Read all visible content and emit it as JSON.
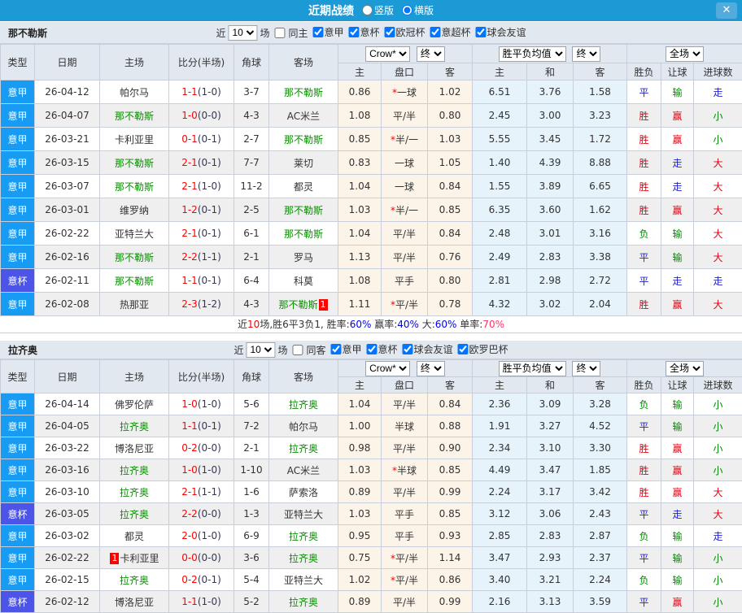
{
  "titlebar": {
    "title": "近期战绩",
    "radios": [
      {
        "label": "竖版",
        "checked": false
      },
      {
        "label": "横版",
        "checked": true
      }
    ],
    "close_label": "✕"
  },
  "colors": {
    "titlebar_bg": "#1b9ad6",
    "league_type_bg": "#189bf2",
    "cup_type_bg": "#4c55e8",
    "focus_team_green": "#089000",
    "score_red": "#ff0000",
    "win_red": "#e60012",
    "draw_blue": "#1f1fd0",
    "lose_green": "#008800",
    "asian_odds_bg": "#fcf4e8",
    "euro_odds_bg": "#e6f3fa"
  },
  "filter": {
    "near": "近",
    "count": "10",
    "games": "场"
  },
  "table_header": {
    "type": "类型",
    "date": "日期",
    "home": "主场",
    "score": "比分(半场)",
    "corner": "角球",
    "away": "客场",
    "asian": {
      "source": "Crow*",
      "final": "终",
      "home": "主",
      "line": "盘口",
      "away": "客"
    },
    "euro": {
      "source": "胜平负均值",
      "final": "终",
      "home": "主",
      "draw": "和",
      "away": "客"
    },
    "result": {
      "scope": "全场",
      "outcome": "胜负",
      "handicap": "让球",
      "goals": "进球数"
    }
  },
  "sections": [
    {
      "team": "那不勒斯",
      "same": {
        "label": "同主",
        "checked": false
      },
      "leagues": [
        {
          "label": "意甲",
          "checked": true
        },
        {
          "label": "意杯",
          "checked": true
        },
        {
          "label": "欧冠杯",
          "checked": true
        },
        {
          "label": "意超杯",
          "checked": true
        },
        {
          "label": "球会友谊",
          "checked": true
        }
      ],
      "rows": [
        {
          "type": "意甲",
          "cup": false,
          "date": "26-04-12",
          "home": "帕尔马",
          "home_green": false,
          "score": "1-1",
          "half": "(1-0)",
          "corner": "3-7",
          "away": "那不勒斯",
          "away_green": true,
          "o1": "0.86",
          "line": "*一球",
          "o2": "1.02",
          "e1": "6.51",
          "e2": "3.76",
          "e3": "1.58",
          "res": "平",
          "hand": "输",
          "goals": "走"
        },
        {
          "type": "意甲",
          "cup": false,
          "date": "26-04-07",
          "home": "那不勒斯",
          "home_green": true,
          "score": "1-0",
          "half": "(0-0)",
          "corner": "4-3",
          "away": "AC米兰",
          "away_green": false,
          "o1": "1.08",
          "line": "平/半",
          "o2": "0.80",
          "e1": "2.45",
          "e2": "3.00",
          "e3": "3.23",
          "res": "胜",
          "hand": "赢",
          "goals": "小"
        },
        {
          "type": "意甲",
          "cup": false,
          "date": "26-03-21",
          "home": "卡利亚里",
          "home_green": false,
          "score": "0-1",
          "half": "(0-1)",
          "corner": "2-7",
          "away": "那不勒斯",
          "away_green": true,
          "o1": "0.85",
          "line": "*半/一",
          "o2": "1.03",
          "e1": "5.55",
          "e2": "3.45",
          "e3": "1.72",
          "res": "胜",
          "hand": "赢",
          "goals": "小"
        },
        {
          "type": "意甲",
          "cup": false,
          "date": "26-03-15",
          "home": "那不勒斯",
          "home_green": true,
          "score": "2-1",
          "half": "(0-1)",
          "corner": "7-7",
          "away": "莱切",
          "away_green": false,
          "o1": "0.83",
          "line": "一球",
          "o2": "1.05",
          "e1": "1.40",
          "e2": "4.39",
          "e3": "8.88",
          "res": "胜",
          "hand": "走",
          "goals": "大"
        },
        {
          "type": "意甲",
          "cup": false,
          "date": "26-03-07",
          "home": "那不勒斯",
          "home_green": true,
          "score": "2-1",
          "half": "(1-0)",
          "corner": "11-2",
          "away": "都灵",
          "away_green": false,
          "o1": "1.04",
          "line": "一球",
          "o2": "0.84",
          "e1": "1.55",
          "e2": "3.89",
          "e3": "6.65",
          "res": "胜",
          "hand": "走",
          "goals": "大"
        },
        {
          "type": "意甲",
          "cup": false,
          "date": "26-03-01",
          "home": "维罗纳",
          "home_green": false,
          "score": "1-2",
          "half": "(0-1)",
          "corner": "2-5",
          "away": "那不勒斯",
          "away_green": true,
          "o1": "1.03",
          "line": "*半/一",
          "o2": "0.85",
          "e1": "6.35",
          "e2": "3.60",
          "e3": "1.62",
          "res": "胜",
          "hand": "赢",
          "goals": "大"
        },
        {
          "type": "意甲",
          "cup": false,
          "date": "26-02-22",
          "home": "亚特兰大",
          "home_green": false,
          "score": "2-1",
          "half": "(0-1)",
          "corner": "6-1",
          "away": "那不勒斯",
          "away_green": true,
          "o1": "1.04",
          "line": "平/半",
          "o2": "0.84",
          "e1": "2.48",
          "e2": "3.01",
          "e3": "3.16",
          "res": "负",
          "hand": "输",
          "goals": "大"
        },
        {
          "type": "意甲",
          "cup": false,
          "date": "26-02-16",
          "home": "那不勒斯",
          "home_green": true,
          "score": "2-2",
          "half": "(1-1)",
          "corner": "2-1",
          "away": "罗马",
          "away_green": false,
          "o1": "1.13",
          "line": "平/半",
          "o2": "0.76",
          "e1": "2.49",
          "e2": "2.83",
          "e3": "3.38",
          "res": "平",
          "hand": "输",
          "goals": "大"
        },
        {
          "type": "意杯",
          "cup": true,
          "date": "26-02-11",
          "home": "那不勒斯",
          "home_green": true,
          "score": "1-1",
          "half": "(0-1)",
          "corner": "6-4",
          "away": "科莫",
          "away_green": false,
          "o1": "1.08",
          "line": "平手",
          "o2": "0.80",
          "e1": "2.81",
          "e2": "2.98",
          "e3": "2.72",
          "res": "平",
          "hand": "走",
          "goals": "走"
        },
        {
          "type": "意甲",
          "cup": false,
          "date": "26-02-08",
          "home": "热那亚",
          "home_green": false,
          "score": "2-3",
          "half": "(1-2)",
          "corner": "4-3",
          "away": "那不勒斯",
          "away_green": true,
          "away_badge": "1",
          "o1": "1.11",
          "line": "*平/半",
          "o2": "0.78",
          "e1": "4.32",
          "e2": "3.02",
          "e3": "2.04",
          "res": "胜",
          "hand": "赢",
          "goals": "大"
        }
      ],
      "summary": [
        {
          "text": "近",
          "color": "s-dark"
        },
        {
          "text": "10",
          "color": "s-red"
        },
        {
          "text": "场,胜6平3负1, 胜率:",
          "color": "s-dark"
        },
        {
          "text": "60%",
          "color": "s-blue"
        },
        {
          "text": " 赢率:",
          "color": "s-dark"
        },
        {
          "text": "40%",
          "color": "s-blue"
        },
        {
          "text": " 大:",
          "color": "s-dark"
        },
        {
          "text": "60%",
          "color": "s-blue"
        },
        {
          "text": " 单率:",
          "color": "s-dark"
        },
        {
          "text": "70%",
          "color": "s-crimson"
        }
      ]
    },
    {
      "team": "拉齐奥",
      "same": {
        "label": "同客",
        "checked": false
      },
      "leagues": [
        {
          "label": "意甲",
          "checked": true
        },
        {
          "label": "意杯",
          "checked": true
        },
        {
          "label": "球会友谊",
          "checked": true
        },
        {
          "label": "欧罗巴杯",
          "checked": true
        }
      ],
      "rows": [
        {
          "type": "意甲",
          "cup": false,
          "date": "26-04-14",
          "home": "佛罗伦萨",
          "home_green": false,
          "score": "1-0",
          "half": "(1-0)",
          "corner": "5-6",
          "away": "拉齐奥",
          "away_green": true,
          "o1": "1.04",
          "line": "平/半",
          "o2": "0.84",
          "e1": "2.36",
          "e2": "3.09",
          "e3": "3.28",
          "res": "负",
          "hand": "输",
          "goals": "小"
        },
        {
          "type": "意甲",
          "cup": false,
          "date": "26-04-05",
          "home": "拉齐奥",
          "home_green": true,
          "score": "1-1",
          "half": "(0-1)",
          "corner": "7-2",
          "away": "帕尔马",
          "away_green": false,
          "o1": "1.00",
          "line": "半球",
          "o2": "0.88",
          "e1": "1.91",
          "e2": "3.27",
          "e3": "4.52",
          "res": "平",
          "hand": "输",
          "goals": "小"
        },
        {
          "type": "意甲",
          "cup": false,
          "date": "26-03-22",
          "home": "博洛尼亚",
          "home_green": false,
          "score": "0-2",
          "half": "(0-0)",
          "corner": "2-1",
          "away": "拉齐奥",
          "away_green": true,
          "o1": "0.98",
          "line": "平/半",
          "o2": "0.90",
          "e1": "2.34",
          "e2": "3.10",
          "e3": "3.30",
          "res": "胜",
          "hand": "赢",
          "goals": "小"
        },
        {
          "type": "意甲",
          "cup": false,
          "date": "26-03-16",
          "home": "拉齐奥",
          "home_green": true,
          "score": "1-0",
          "half": "(1-0)",
          "corner": "1-10",
          "away": "AC米兰",
          "away_green": false,
          "o1": "1.03",
          "line": "*半球",
          "o2": "0.85",
          "e1": "4.49",
          "e2": "3.47",
          "e3": "1.85",
          "res": "胜",
          "hand": "赢",
          "goals": "小"
        },
        {
          "type": "意甲",
          "cup": false,
          "date": "26-03-10",
          "home": "拉齐奥",
          "home_green": true,
          "score": "2-1",
          "half": "(1-1)",
          "corner": "1-6",
          "away": "萨索洛",
          "away_green": false,
          "o1": "0.89",
          "line": "平/半",
          "o2": "0.99",
          "e1": "2.24",
          "e2": "3.17",
          "e3": "3.42",
          "res": "胜",
          "hand": "赢",
          "goals": "大"
        },
        {
          "type": "意杯",
          "cup": true,
          "date": "26-03-05",
          "home": "拉齐奥",
          "home_green": true,
          "score": "2-2",
          "half": "(0-0)",
          "corner": "1-3",
          "away": "亚特兰大",
          "away_green": false,
          "o1": "1.03",
          "line": "平手",
          "o2": "0.85",
          "e1": "3.12",
          "e2": "3.06",
          "e3": "2.43",
          "res": "平",
          "hand": "走",
          "goals": "大"
        },
        {
          "type": "意甲",
          "cup": false,
          "date": "26-03-02",
          "home": "都灵",
          "home_green": false,
          "score": "2-0",
          "half": "(1-0)",
          "corner": "6-9",
          "away": "拉齐奥",
          "away_green": true,
          "o1": "0.95",
          "line": "平手",
          "o2": "0.93",
          "e1": "2.85",
          "e2": "2.83",
          "e3": "2.87",
          "res": "负",
          "hand": "输",
          "goals": "走"
        },
        {
          "type": "意甲",
          "cup": false,
          "date": "26-02-22",
          "home": "卡利亚里",
          "home_green": false,
          "home_badge": "1",
          "home_badge_before": true,
          "score": "0-0",
          "half": "(0-0)",
          "corner": "3-6",
          "away": "拉齐奥",
          "away_green": true,
          "o1": "0.75",
          "line": "*平/半",
          "o2": "1.14",
          "e1": "3.47",
          "e2": "2.93",
          "e3": "2.37",
          "res": "平",
          "hand": "输",
          "goals": "小"
        },
        {
          "type": "意甲",
          "cup": false,
          "date": "26-02-15",
          "home": "拉齐奥",
          "home_green": true,
          "score": "0-2",
          "half": "(0-1)",
          "corner": "5-4",
          "away": "亚特兰大",
          "away_green": false,
          "o1": "1.02",
          "line": "*平/半",
          "o2": "0.86",
          "e1": "3.40",
          "e2": "3.21",
          "e3": "2.24",
          "res": "负",
          "hand": "输",
          "goals": "小"
        },
        {
          "type": "意杯",
          "cup": true,
          "date": "26-02-12",
          "home": "博洛尼亚",
          "home_green": false,
          "score": "1-1",
          "half": "(1-0)",
          "corner": "5-2",
          "away": "拉齐奥",
          "away_green": true,
          "o1": "0.89",
          "line": "平/半",
          "o2": "0.99",
          "e1": "2.16",
          "e2": "3.13",
          "e3": "3.59",
          "res": "平",
          "hand": "赢",
          "goals": "小"
        }
      ]
    }
  ]
}
